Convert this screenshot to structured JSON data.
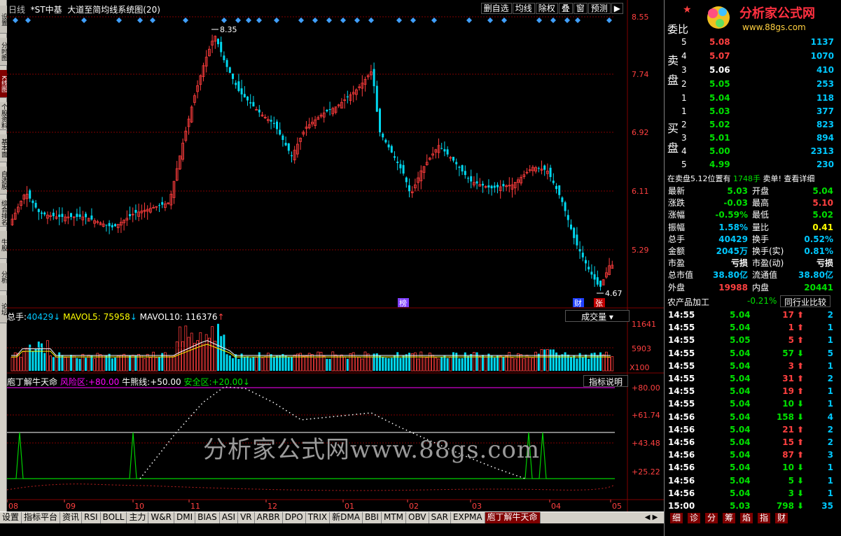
{
  "window": {
    "title_prefix": "日线",
    "stock_name": "*ST中基",
    "indicator_name": "大道至简均线系统图(20)"
  },
  "toolbar": {
    "buttons": [
      "删自选",
      "均线",
      "除权",
      "叠",
      "窗",
      "预测"
    ],
    "arrow": "▶"
  },
  "left_tabs": [
    "设置",
    "分时图",
    "K线图",
    "个股资料",
    "基本面",
    "自选股",
    "综合排名",
    "牛股",
    "分析",
    "论坛"
  ],
  "price_axis": {
    "labels": [
      "8.55",
      "7.74",
      "6.92",
      "6.11",
      "5.29"
    ],
    "high_label": "8.35",
    "low_label": "4.67"
  },
  "markers": {
    "bang": "榜",
    "cai": "财",
    "zhang": "张"
  },
  "volume": {
    "title_label": "总手:",
    "total": "40429",
    "total_arrow": "↓",
    "mavol5_label": "MAVOL5:",
    "mavol5": "75958",
    "mavol5_arrow": "↓",
    "mavol10_label": "MAVOL10:",
    "mavol10": "116376",
    "mavol10_arrow": "↑",
    "dropdown": "成交量",
    "axis": [
      "11641",
      "5903"
    ],
    "multiplier": "X100"
  },
  "indicator": {
    "name": "庖丁解牛天命",
    "risk_label": "风险区:",
    "risk": "+80.00",
    "bull_label": "牛熊线:",
    "bull": "+50.00",
    "safe_label": "安全区:",
    "safe": "+20.00",
    "safe_arrow": "↓",
    "help": "指标说明",
    "axis": [
      "+80.00",
      "+61.74",
      "+43.48",
      "+25.22"
    ]
  },
  "x_axis": {
    "labels": [
      "08",
      "09",
      "10",
      "11",
      "12",
      "01",
      "02",
      "03",
      "04",
      "05"
    ]
  },
  "watermark": "分析家公式网www.88gs.com",
  "logo": {
    "text": "分析家公式网",
    "url_text": "www.88gs.com"
  },
  "orderbook": {
    "title": "委比",
    "sell_label": "卖盘",
    "buy_label": "买盘",
    "sell": [
      {
        "lvl": "5",
        "price": "5.08",
        "vol": "1137",
        "color": "red"
      },
      {
        "lvl": "4",
        "price": "5.07",
        "vol": "1070",
        "color": "red"
      },
      {
        "lvl": "3",
        "price": "5.06",
        "vol": "410",
        "color": "white"
      },
      {
        "lvl": "2",
        "price": "5.05",
        "vol": "253",
        "color": "green"
      },
      {
        "lvl": "1",
        "price": "5.04",
        "vol": "118",
        "color": "green"
      }
    ],
    "buy": [
      {
        "lvl": "1",
        "price": "5.03",
        "vol": "377",
        "color": "green"
      },
      {
        "lvl": "2",
        "price": "5.02",
        "vol": "823",
        "color": "green"
      },
      {
        "lvl": "3",
        "price": "5.01",
        "vol": "894",
        "color": "green"
      },
      {
        "lvl": "4",
        "price": "5.00",
        "vol": "2313",
        "color": "green"
      },
      {
        "lvl": "5",
        "price": "4.99",
        "vol": "230",
        "color": "green"
      }
    ],
    "notice_a": "在卖盘5.12位置有",
    "notice_b": "1748手",
    "notice_c": "卖单!",
    "notice_d": "查看详细"
  },
  "quote": [
    {
      "l1": "最新",
      "v1": "5.03",
      "c1": "green",
      "l2": "开盘",
      "v2": "5.04",
      "c2": "green"
    },
    {
      "l1": "涨跌",
      "v1": "-0.03",
      "c1": "green",
      "l2": "最高",
      "v2": "5.10",
      "c2": "red"
    },
    {
      "l1": "涨幅",
      "v1": "-0.59%",
      "c1": "green",
      "l2": "最低",
      "v2": "5.02",
      "c2": "green"
    },
    {
      "l1": "振幅",
      "v1": "1.58%",
      "c1": "cyan",
      "l2": "量比",
      "v2": "0.41",
      "c2": "yellow"
    },
    {
      "l1": "总手",
      "v1": "40429",
      "c1": "cyan",
      "l2": "换手",
      "v2": "0.52%",
      "c2": "cyan"
    },
    {
      "l1": "金额",
      "v1": "2045万",
      "c1": "cyan",
      "l2": "换手(实)",
      "v2": "0.81%",
      "c2": "cyan"
    },
    {
      "l1": "市盈",
      "v1": "亏损",
      "c1": "white",
      "l2": "市盈(动)",
      "v2": "亏损",
      "c2": "white"
    },
    {
      "l1": "总市值",
      "v1": "38.80亿",
      "c1": "cyan",
      "l2": "流通值",
      "v2": "38.80亿",
      "c2": "cyan"
    },
    {
      "l1": "外盘",
      "v1": "19988",
      "c1": "red",
      "l2": "内盘",
      "v2": "20441",
      "c2": "green"
    }
  ],
  "industry": {
    "name": "农产品加工",
    "change": "-0.21%",
    "button": "同行业比较"
  },
  "ticks": [
    {
      "t": "14:55",
      "p": "5.04",
      "v": "17",
      "dir": "up",
      "n": "2"
    },
    {
      "t": "14:55",
      "p": "5.04",
      "v": "1",
      "dir": "up",
      "n": "1"
    },
    {
      "t": "14:55",
      "p": "5.05",
      "v": "5",
      "dir": "up",
      "n": "1"
    },
    {
      "t": "14:55",
      "p": "5.04",
      "v": "57",
      "dir": "down",
      "n": "5"
    },
    {
      "t": "14:55",
      "p": "5.04",
      "v": "3",
      "dir": "up",
      "n": "1"
    },
    {
      "t": "14:55",
      "p": "5.04",
      "v": "31",
      "dir": "up",
      "n": "2"
    },
    {
      "t": "14:55",
      "p": "5.04",
      "v": "19",
      "dir": "up",
      "n": "1"
    },
    {
      "t": "14:55",
      "p": "5.04",
      "v": "10",
      "dir": "down",
      "n": "1"
    },
    {
      "t": "14:56",
      "p": "5.04",
      "v": "158",
      "dir": "down",
      "n": "4"
    },
    {
      "t": "14:56",
      "p": "5.04",
      "v": "21",
      "dir": "up",
      "n": "2"
    },
    {
      "t": "14:56",
      "p": "5.04",
      "v": "15",
      "dir": "up",
      "n": "2"
    },
    {
      "t": "14:56",
      "p": "5.04",
      "v": "87",
      "dir": "up",
      "n": "3"
    },
    {
      "t": "14:56",
      "p": "5.04",
      "v": "10",
      "dir": "down",
      "n": "1"
    },
    {
      "t": "14:56",
      "p": "5.04",
      "v": "5",
      "dir": "down",
      "n": "1"
    },
    {
      "t": "14:56",
      "p": "5.04",
      "v": "3",
      "dir": "down",
      "n": "1"
    },
    {
      "t": "15:00",
      "p": "5.03",
      "v": "798",
      "dir": "down",
      "n": "35"
    }
  ],
  "bottom_tabs": [
    "设置",
    "指标平台",
    "资讯",
    "RSI",
    "BOLL",
    "主力",
    "W&R",
    "DMI",
    "BIAS",
    "ASI",
    "VR",
    "ARBR",
    "DPO",
    "TRIX",
    "新DMA",
    "BBI",
    "MTM",
    "OBV",
    "SAR",
    "EXPMA",
    "庖丁解牛天命"
  ],
  "right_tabs": [
    "细",
    "诊",
    "分",
    "筹",
    "焰",
    "指",
    "财"
  ],
  "colors": {
    "up": "#ff3c3c",
    "down": "#00d8f0",
    "grid": "#800000",
    "ma_white": "#ffffff",
    "ma_yellow": "#ffff00",
    "ind_green": "#00d000"
  }
}
